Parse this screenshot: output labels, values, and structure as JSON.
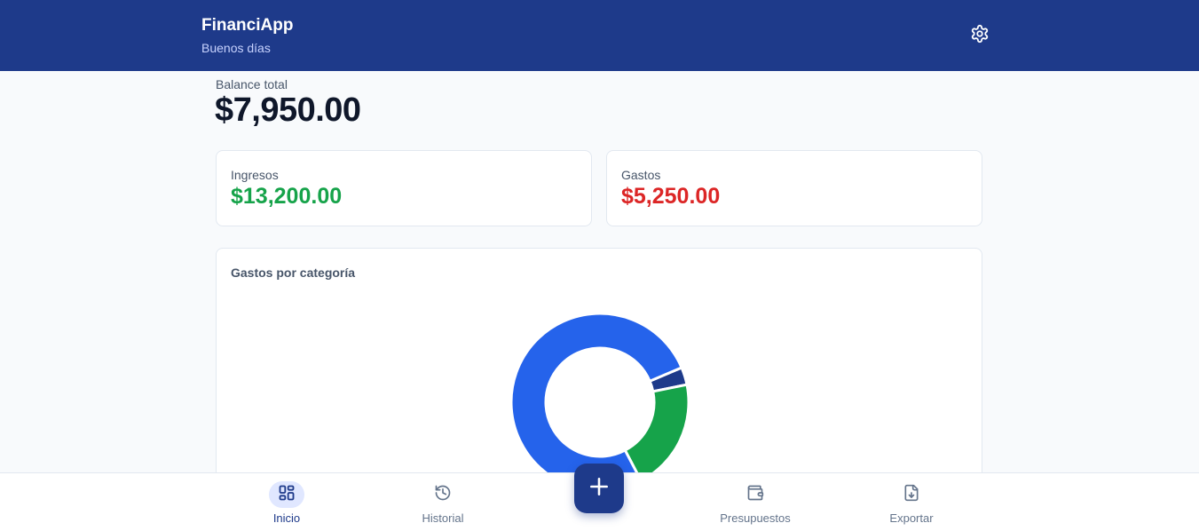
{
  "header": {
    "title": "FinanciApp",
    "greeting": "Buenos días",
    "settings_icon": "gear-icon"
  },
  "balance": {
    "label": "Balance total",
    "value": "$7,950.00"
  },
  "summary": {
    "income": {
      "label": "Ingresos",
      "value": "$13,200.00",
      "color": "#16a34a"
    },
    "expense": {
      "label": "Gastos",
      "value": "$5,250.00",
      "color": "#dc2626"
    }
  },
  "chart_card": {
    "title": "Gastos por categoría"
  },
  "chart_data": {
    "type": "pie",
    "title": "Gastos por categoría",
    "donut": true,
    "series": [
      {
        "value": 3.2,
        "color": "#1e3a8a"
      },
      {
        "value": 20.5,
        "color": "#16a34a"
      },
      {
        "value": 76.3,
        "color": "#2563eb"
      }
    ]
  },
  "nav": {
    "items": [
      {
        "label": "Inicio",
        "icon": "dashboard-icon",
        "active": true
      },
      {
        "label": "Historial",
        "icon": "history-icon",
        "active": false
      },
      {
        "label": "Presupuestos",
        "icon": "wallet-icon",
        "active": false
      },
      {
        "label": "Exportar",
        "icon": "file-download-icon",
        "active": false
      }
    ],
    "fab_icon": "plus-icon"
  },
  "colors": {
    "primary": "#1e3a8a",
    "accent_blue": "#2563eb",
    "background": "#f8fafc"
  }
}
